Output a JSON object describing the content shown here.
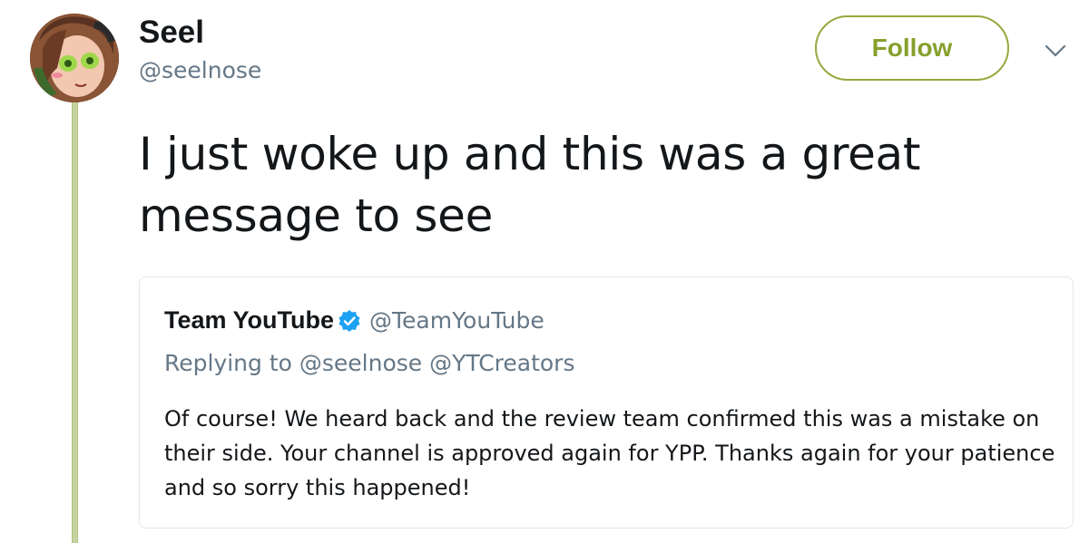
{
  "author": {
    "display_name": "Seel",
    "handle": "@seelnose"
  },
  "follow_label": "Follow",
  "tweet_text": "I just woke up and this was a great message to see",
  "quoted_tweet": {
    "display_name": "Team YouTube",
    "handle": "@TeamYouTube",
    "replying_to": "Replying to @seelnose @YTCreators",
    "text": "Of course! We heard back and the review team confirmed this was a mistake on their side. Your channel is approved again for YPP. Thanks again for your patience and so sorry this happened!",
    "verified_icon": "verified-badge-icon"
  },
  "icons": {
    "menu": "chevron-down-icon",
    "avatar": "user-avatar"
  },
  "colors": {
    "accent": "#86a02c",
    "thread_line": "#c5d39f",
    "verified": "#1da1f2",
    "secondary_text": "#657786"
  }
}
